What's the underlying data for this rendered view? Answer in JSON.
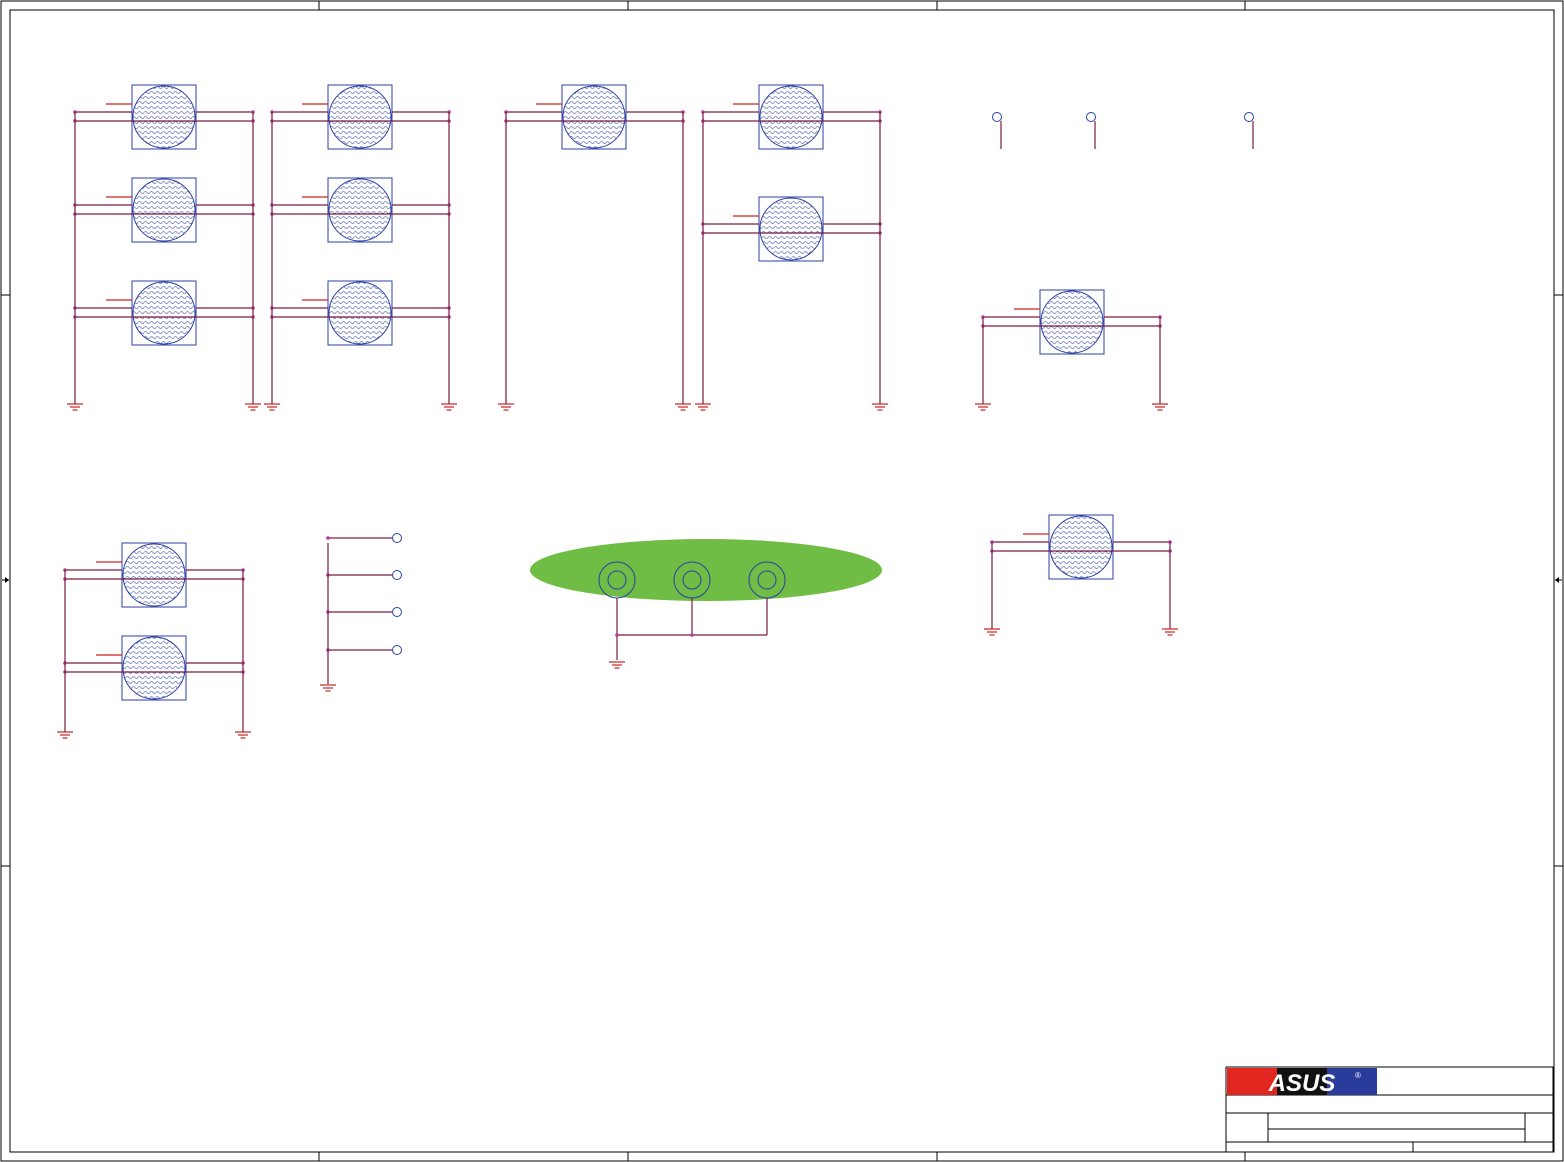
{
  "title_block": {
    "logo_text": "ASUS",
    "registered_mark": "®",
    "logo_colors": {
      "red": "#e0261f",
      "black": "#111111",
      "blue": "#2a3c9b"
    }
  },
  "colors": {
    "wire": "#7a1c3e",
    "pin": "#cc2222",
    "symbol_outline": "#2b3fa6",
    "junction": "#b03aa0",
    "gasket_fill": "#6fbd44"
  },
  "icons": {
    "mounting_hole": "hatched-circle-in-square",
    "ground": "ground-symbol",
    "test_point": "open-circle",
    "off_sheet_arrow": "arrow-triangle"
  }
}
